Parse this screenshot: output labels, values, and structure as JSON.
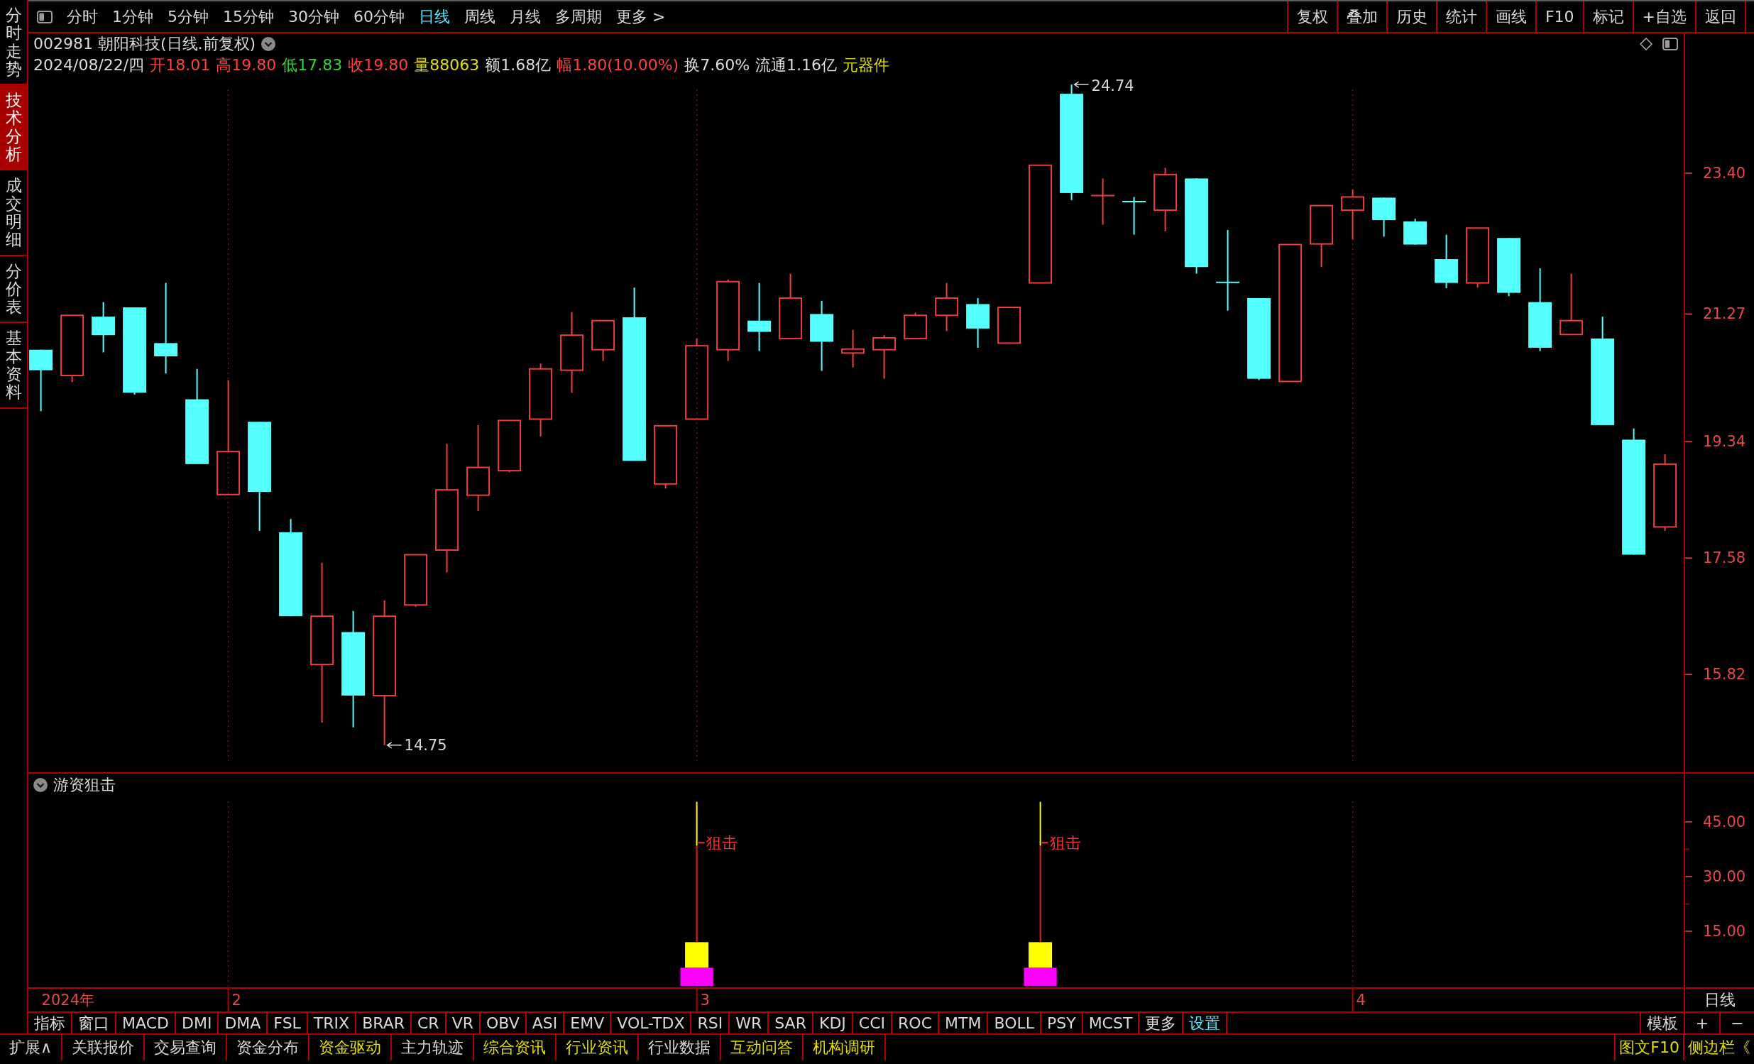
{
  "sidebar": {
    "tabs": [
      {
        "label": "分时走势",
        "selected": false
      },
      {
        "label": "技术分析",
        "selected": true
      },
      {
        "label": "成交明细",
        "selected": false
      },
      {
        "label": "分价表",
        "selected": false
      },
      {
        "label": "基本资料",
        "selected": false
      }
    ]
  },
  "toolbar": {
    "periods": [
      {
        "label": "分时",
        "selected": false
      },
      {
        "label": "1分钟",
        "selected": false
      },
      {
        "label": "5分钟",
        "selected": false
      },
      {
        "label": "15分钟",
        "selected": false
      },
      {
        "label": "30分钟",
        "selected": false
      },
      {
        "label": "60分钟",
        "selected": false
      },
      {
        "label": "日线",
        "selected": true
      },
      {
        "label": "周线",
        "selected": false
      },
      {
        "label": "月线",
        "selected": false
      },
      {
        "label": "多周期",
        "selected": false
      },
      {
        "label": "更多 >",
        "selected": false
      }
    ],
    "actions": [
      "复权",
      "叠加",
      "历史",
      "统计",
      "画线",
      "F10",
      "标记",
      "+自选",
      "返回"
    ]
  },
  "header": {
    "title": "002981 朝阳科技(日线.前复权)",
    "quote": [
      {
        "text": "2024/08/22/四",
        "color": "#dcdcdc"
      },
      {
        "text": "开18.01",
        "color": "#ff4040"
      },
      {
        "text": "高19.80",
        "color": "#ff4040"
      },
      {
        "text": "低17.83",
        "color": "#33d633"
      },
      {
        "text": "收19.80",
        "color": "#ff4040"
      },
      {
        "text": "量88063",
        "color": "#e0e000"
      },
      {
        "text": "额1.68亿",
        "color": "#dcdcdc"
      },
      {
        "text": "幅1.80(10.00%)",
        "color": "#ff4040"
      },
      {
        "text": "换7.60%",
        "color": "#dcdcdc"
      },
      {
        "text": "流通1.16亿",
        "color": "#dcdcdc"
      },
      {
        "text": "元器件",
        "color": "#e0e000"
      }
    ]
  },
  "main_chart": {
    "price_axis": [
      "23.40",
      "21.27",
      "19.34",
      "17.58",
      "15.82"
    ],
    "callouts": [
      "24.74",
      "14.75"
    ]
  },
  "indicator": {
    "chart_data": {
      "type": "bar",
      "title": "游资狙击",
      "categories": [
        "2024年",
        null,
        null,
        null,
        null,
        null,
        "2",
        null,
        null,
        null,
        null,
        null,
        null,
        null,
        null,
        null,
        null,
        null,
        null,
        null,
        null,
        "3",
        null,
        null,
        null,
        null,
        null,
        null,
        null,
        null,
        null,
        null,
        null,
        null,
        null,
        null,
        null,
        null,
        null,
        null,
        null,
        null,
        "4",
        null,
        null,
        null,
        null,
        null,
        null,
        null,
        null,
        null,
        null
      ],
      "ylim": [
        -0.4,
        52
      ],
      "yticks": [
        {
          "value": 15,
          "label": "15.00"
        },
        {
          "value": 30,
          "label": "30.00"
        },
        {
          "value": 45,
          "label": "45.00"
        }
      ],
      "stacked": true,
      "series": [
        {
          "color": "#ff00ff",
          "values": [
            null,
            null,
            null,
            null,
            null,
            null,
            null,
            null,
            null,
            null,
            null,
            null,
            null,
            null,
            null,
            null,
            null,
            null,
            null,
            null,
            null,
            5,
            null,
            null,
            null,
            null,
            null,
            null,
            null,
            null,
            null,
            null,
            5,
            null,
            null,
            null,
            null,
            null,
            null,
            null,
            null,
            null,
            null,
            null,
            null,
            null,
            null,
            null,
            null,
            null,
            null,
            null,
            null
          ]
        },
        {
          "color": "#ffff00",
          "values": [
            null,
            null,
            null,
            null,
            null,
            null,
            null,
            null,
            null,
            null,
            null,
            null,
            null,
            null,
            null,
            null,
            null,
            null,
            null,
            null,
            null,
            7,
            null,
            null,
            null,
            null,
            null,
            null,
            null,
            null,
            null,
            null,
            7,
            null,
            null,
            null,
            null,
            null,
            null,
            null,
            null,
            null,
            null,
            null,
            null,
            null,
            null,
            null,
            null,
            null,
            null,
            null,
            null
          ]
        },
        {
          "color": "#e02020",
          "values": [
            null,
            null,
            null,
            null,
            null,
            null,
            null,
            null,
            null,
            null,
            null,
            null,
            null,
            null,
            null,
            null,
            null,
            null,
            null,
            null,
            null,
            26.5,
            null,
            null,
            null,
            null,
            null,
            null,
            null,
            null,
            null,
            null,
            26.5,
            null,
            null,
            null,
            null,
            null,
            null,
            null,
            null,
            null,
            null,
            null,
            null,
            null,
            null,
            null,
            null,
            null,
            null,
            null,
            null
          ]
        },
        {
          "color": "#ffff00",
          "values": [
            null,
            null,
            null,
            null,
            null,
            null,
            null,
            null,
            null,
            null,
            null,
            null,
            null,
            null,
            null,
            null,
            null,
            null,
            null,
            null,
            null,
            12,
            null,
            null,
            null,
            null,
            null,
            null,
            null,
            null,
            null,
            null,
            12,
            null,
            null,
            null,
            null,
            null,
            null,
            null,
            null,
            null,
            null,
            null,
            null,
            null,
            null,
            null,
            null,
            null,
            null,
            null,
            null
          ]
        }
      ],
      "annotations": [
        "狙击",
        "狙击"
      ]
    }
  },
  "time_axis": {
    "period": "日线"
  },
  "indicator_tabs": {
    "items": [
      {
        "label": "指标",
        "highlighted": false
      },
      {
        "label": "窗口",
        "highlighted": false
      },
      {
        "label": "MACD",
        "highlighted": false
      },
      {
        "label": "DMI",
        "highlighted": false
      },
      {
        "label": "DMA",
        "highlighted": false
      },
      {
        "label": "FSL",
        "highlighted": false
      },
      {
        "label": "TRIX",
        "highlighted": false
      },
      {
        "label": "BRAR",
        "highlighted": false
      },
      {
        "label": "CR",
        "highlighted": false
      },
      {
        "label": "VR",
        "highlighted": false
      },
      {
        "label": "OBV",
        "highlighted": false
      },
      {
        "label": "ASI",
        "highlighted": false
      },
      {
        "label": "EMV",
        "highlighted": false
      },
      {
        "label": "VOL-TDX",
        "highlighted": false
      },
      {
        "label": "RSI",
        "highlighted": false
      },
      {
        "label": "WR",
        "highlighted": false
      },
      {
        "label": "SAR",
        "highlighted": false
      },
      {
        "label": "KDJ",
        "highlighted": false
      },
      {
        "label": "CCI",
        "highlighted": false
      },
      {
        "label": "ROC",
        "highlighted": false
      },
      {
        "label": "MTM",
        "highlighted": false
      },
      {
        "label": "BOLL",
        "highlighted": false
      },
      {
        "label": "PSY",
        "highlighted": false
      },
      {
        "label": "MCST",
        "highlighted": false
      },
      {
        "label": "更多",
        "highlighted": false
      },
      {
        "label": "设置",
        "highlighted": true
      }
    ],
    "tools": [
      {
        "kind": "template",
        "label": "模板"
      },
      {
        "kind": "plus",
        "label": "+"
      },
      {
        "kind": "minus",
        "label": "−"
      }
    ]
  },
  "bottom_bar": {
    "items": [
      {
        "label": "扩展∧",
        "highlighted": false
      },
      {
        "label": "关联报价",
        "highlighted": false
      },
      {
        "label": "交易查询",
        "highlighted": false
      },
      {
        "label": "资金分布",
        "highlighted": false
      },
      {
        "label": "资金驱动",
        "highlighted": true
      },
      {
        "label": "主力轨迹",
        "highlighted": false
      },
      {
        "label": "综合资讯",
        "highlighted": true
      },
      {
        "label": "行业资讯",
        "highlighted": true
      },
      {
        "label": "行业数据",
        "highlighted": false
      },
      {
        "label": "互动问答",
        "highlighted": true
      },
      {
        "label": "机构调研",
        "highlighted": true
      }
    ],
    "right": [
      {
        "label": "图文F10",
        "highlighted": true
      },
      {
        "label": "侧边栏《",
        "highlighted": true
      }
    ]
  }
}
